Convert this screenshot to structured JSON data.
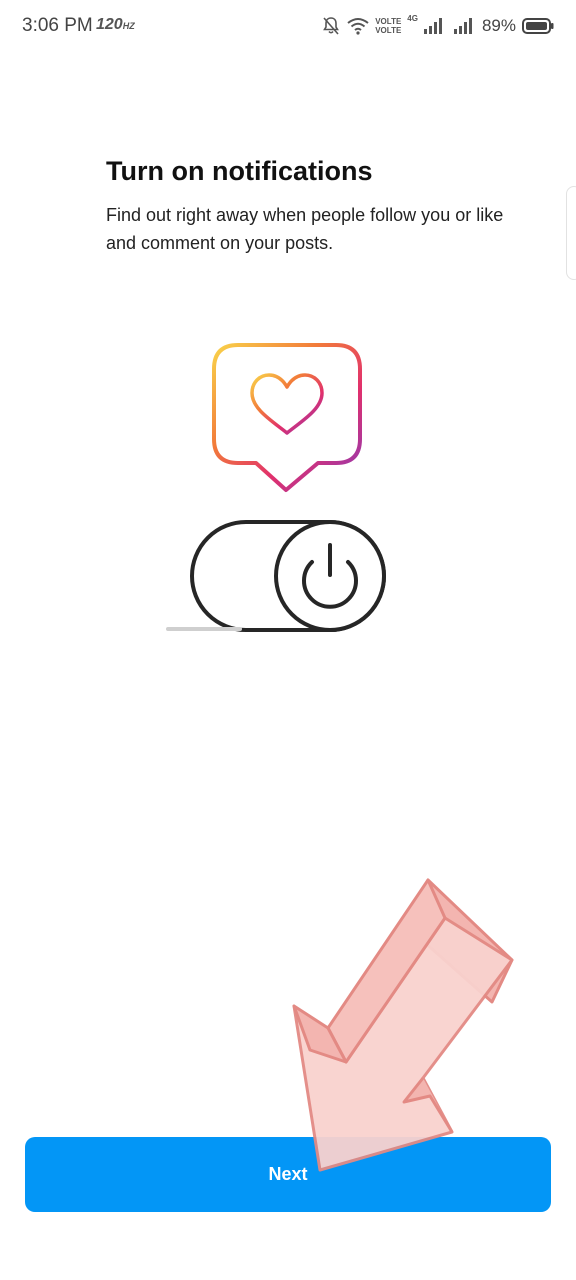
{
  "status_bar": {
    "time": "3:06 PM",
    "refresh_rate": "120",
    "network_label_top": "VOLTE",
    "network_label_bottom": "VOLTE",
    "network_type": "4G",
    "battery_percent": "89%",
    "icons": [
      "bell-off-icon",
      "wifi-icon",
      "signal-icon",
      "battery-icon"
    ]
  },
  "screen": {
    "title": "Turn on notifications",
    "description": "Find out right away when people follow you or like and comment on your posts."
  },
  "illustration": {
    "icons": [
      "heart-bubble-icon",
      "power-toggle-icon"
    ],
    "gradient_colors": [
      "#f9d34a",
      "#f27b3a",
      "#e1306c",
      "#8a3ab9"
    ]
  },
  "footer": {
    "next_label": "Next"
  },
  "overlay": {
    "icon": "pointer-arrow-icon",
    "color": "#f8c8c4"
  },
  "colors": {
    "primary_button": "#0396f6",
    "text": "#111111"
  }
}
